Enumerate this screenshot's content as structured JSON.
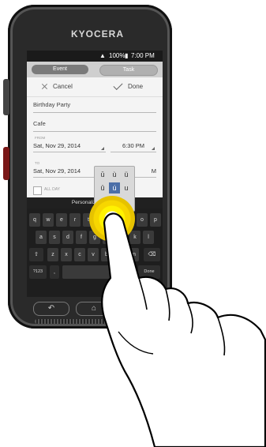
{
  "device": {
    "brand_logo": "KYOCERA"
  },
  "status_bar": {
    "signal_icon": "signal-icon",
    "battery_text": "100%",
    "time": "7:00 PM"
  },
  "tabs": {
    "event_label": "Event",
    "task_label": "Task"
  },
  "actions": {
    "cancel_label": "Cancel",
    "done_label": "Done"
  },
  "form": {
    "title_value": "Birthday Party",
    "location_value": "Cafe",
    "from_label": "FROM",
    "from_date": "Sat, Nov 29, 2014",
    "from_time": "6:30 PM",
    "to_label": "TO",
    "to_date": "Sat, Nov 29, 2014",
    "to_time": "M",
    "all_day_label": "ALL DAY"
  },
  "hint": {
    "text": "Personalization is                 o."
  },
  "accent_popup": {
    "options": [
      "ū",
      "ù",
      "ü",
      "û",
      "ú",
      "u"
    ]
  },
  "keyboard": {
    "row1": [
      "q",
      "w",
      "e",
      "r",
      "t",
      "y",
      "u",
      "i",
      "o",
      "p"
    ],
    "row2": [
      "a",
      "s",
      "d",
      "f",
      "g",
      "h",
      "j",
      "k",
      "l"
    ],
    "row3": [
      "z",
      "x",
      "c",
      "v",
      "b",
      "n",
      "m"
    ],
    "shift_icon": "shift-icon",
    "backspace_icon": "backspace-icon",
    "num_label": "?123",
    "comma_label": ",",
    "done_label": "Done"
  },
  "colors": {
    "screen_bg": "#f4f4f4",
    "touch_highlight": "#f7d600",
    "accent_selected": "#4c6fa8",
    "side_button_red": "#7a1717"
  }
}
